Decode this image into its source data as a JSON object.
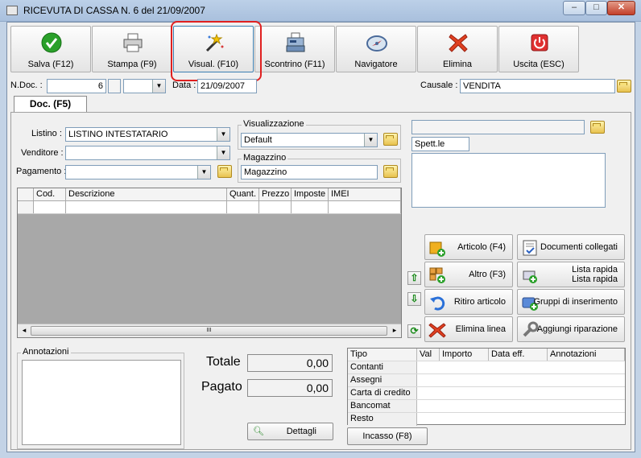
{
  "window": {
    "title": "RICEVUTA DI CASSA N. 6  del 21/09/2007",
    "min": "–",
    "max": "□",
    "close": "✕"
  },
  "toolbar": {
    "save": "Salva (F12)",
    "print": "Stampa (F9)",
    "view": "Visual. (F10)",
    "receipt": "Scontrino (F11)",
    "navigator": "Navigatore",
    "delete": "Elimina",
    "exit": "Uscita (ESC)"
  },
  "header": {
    "ndoc_label": "N.Doc. :",
    "ndoc_value": "6",
    "date_label": "Data :",
    "date_value": "21/09/2007",
    "causale_label": "Causale :",
    "causale_value": "VENDITA"
  },
  "tab": {
    "doc": "Doc. (F5)"
  },
  "form": {
    "listino_label": "Listino :",
    "listino_value": "LISTINO INTESTATARIO",
    "venditore_label": "Venditore :",
    "venditore_value": "",
    "pagamento_label": "Pagamento :",
    "pagamento_value": "",
    "visualizzazione_label": "Visualizzazione",
    "visualizzazione_value": "Default",
    "magazzino_label": "Magazzino",
    "magazzino_value": "Magazzino",
    "customer_field": "",
    "spett": "Spett.le"
  },
  "grid": {
    "columns": [
      "Cod.",
      "Descrizione",
      "Quant.",
      "Prezzo",
      "Imposte",
      "IMEI"
    ],
    "scroll_grip": "III"
  },
  "actions": {
    "articolo": "Articolo (F4)",
    "documenti": "Documenti collegati",
    "altro": "Altro (F3)",
    "lista_rapida_1": "Lista rapida",
    "lista_rapida_2": "Lista rapida",
    "ritiro": "Ritiro articolo",
    "gruppi": "Gruppi di inserimento",
    "elimina_linea": "Elimina linea",
    "riparazione": "Aggiungi riparazione"
  },
  "notes": {
    "label": "Annotazioni"
  },
  "totals": {
    "totale_label": "Totale",
    "totale_value": "0,00",
    "pagato_label": "Pagato",
    "pagato_value": "0,00",
    "dettagli": "Dettagli"
  },
  "payments": {
    "columns": [
      "Tipo",
      "Val",
      "Importo",
      "Data eff.",
      "Annotazioni"
    ],
    "rows": [
      "Contanti",
      "Assegni",
      "Carta di credito",
      "Bancomat",
      "Resto"
    ],
    "incasso": "Incasso (F8)"
  }
}
